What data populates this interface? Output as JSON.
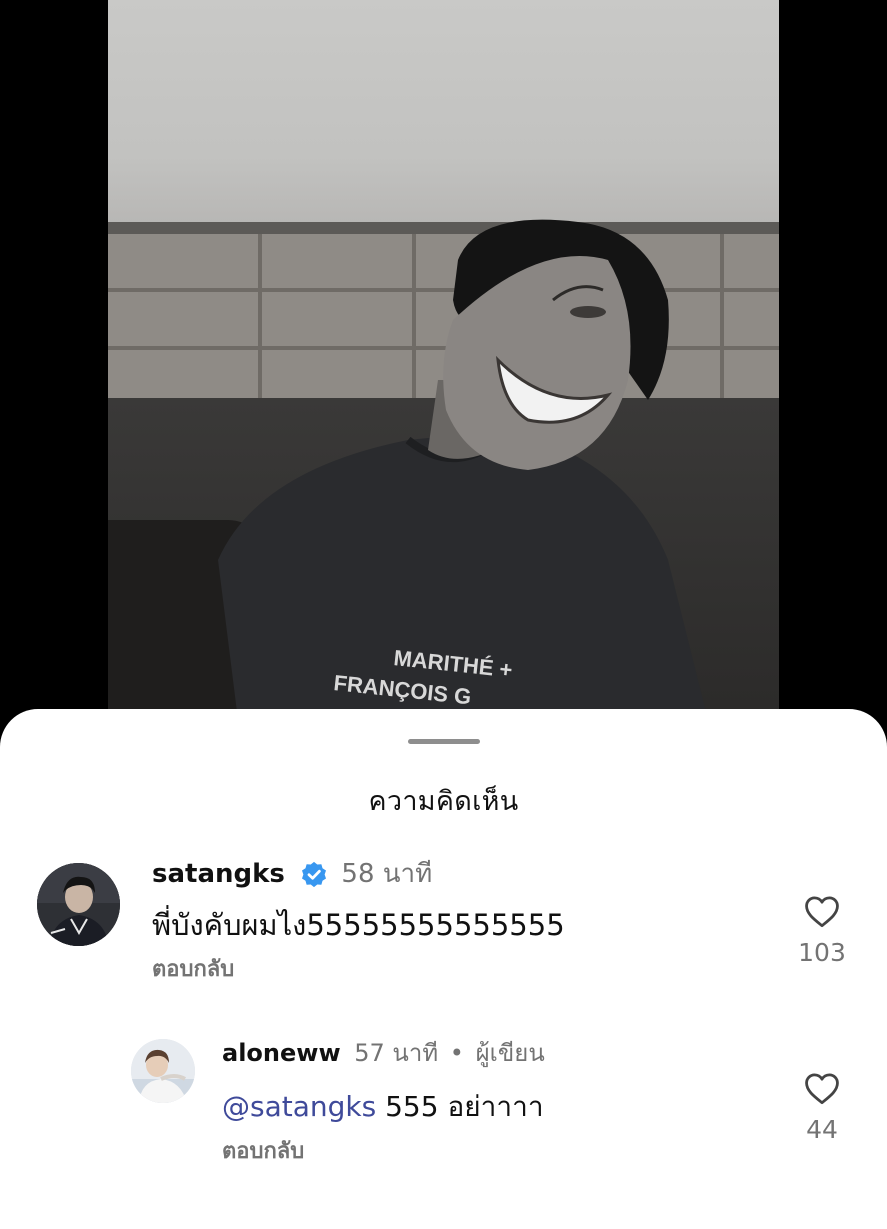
{
  "sheet": {
    "title": "ความคิดเห็น"
  },
  "video": {
    "shirt_text_line1": "MARITHÉ +",
    "shirt_text_line2": "FRANÇOIS G"
  },
  "comments": [
    {
      "username": "satangks",
      "verified": true,
      "time": "58 นาที",
      "text": "พี่บังคับผมไง55555555555555",
      "reply_label": "ตอบกลับ",
      "likes": "103"
    }
  ],
  "replies": [
    {
      "username": "aloneww",
      "time": "57 นาที",
      "separator": "•",
      "author_badge": "ผู้เขียน",
      "mention": "@satangks",
      "text": " 555 อย่าาาา",
      "reply_label": "ตอบกลับ",
      "likes": "44"
    }
  ],
  "icons": {
    "verified": "verified-badge-icon",
    "like": "heart-icon"
  },
  "colors": {
    "verified_blue": "#3897f0",
    "mention": "#3f4a9a",
    "secondary_text": "#737373"
  }
}
